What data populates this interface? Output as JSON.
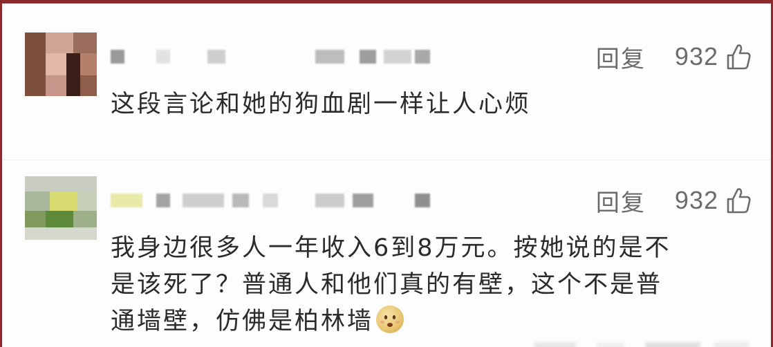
{
  "comments": [
    {
      "reply_label": "回复",
      "like_count": "932",
      "text": "这段言论和她的狗血剧一样让人心烦"
    },
    {
      "reply_label": "回复",
      "like_count": "932",
      "text": "我身边很多人一年收入6到8万元。按她说的是不\n是该死了？普通人和他们真的有壁，这个不是普\n通墙壁，仿佛是柏林墙"
    }
  ],
  "icons": {
    "like": "thumbs-up-icon",
    "emoji": "embarrassed-face-emoji-icon"
  },
  "colors": {
    "frame_border": "#8c2b2b",
    "meta_text": "#6b6b6b",
    "body_text": "#2b2b2b"
  }
}
